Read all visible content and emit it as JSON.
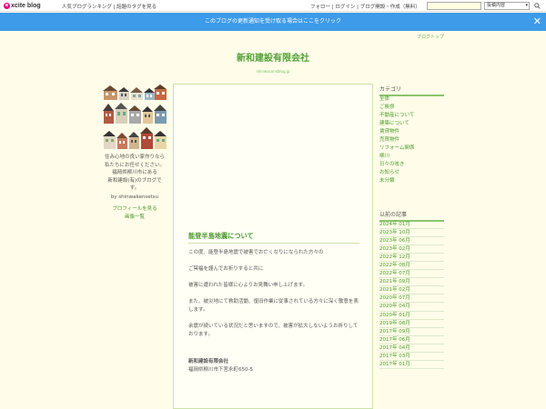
{
  "header": {
    "logo_mark": "e",
    "logo_text": "xcite blog",
    "links_left": "人気ブログランキング | 話題のタグを見る",
    "links_right": "フォロー | ログイン | ブログ開設・作成（無料）",
    "search_placeholder": "",
    "search_scope": "投稿内容"
  },
  "banner": {
    "text": "このブログの更新通知を受け取る場合はここをクリック",
    "close": "✕"
  },
  "blog": {
    "top_link": "ブログトップ",
    "title": "新和建設有限会社",
    "url": "shinwaconsblog.jp"
  },
  "profile": {
    "lines": [
      "住み心地の良い家作りなら",
      "私たちにお任せください。",
      "福岡県柳川市にある",
      "新和建設(有)のブログで",
      "す。"
    ],
    "by": "by shinwakensetsu",
    "profile_link": "プロフィールを見る",
    "image_link": "画像一覧"
  },
  "post": {
    "title": "能登半島地震について",
    "paragraphs": [
      "この度、能登半島地震で被害でお亡くなりになられた方々の",
      "ご冥福を謹んでお祈りすると共に",
      "被害に遭われた皆様に心よりお見舞い申し上げます。",
      "また、被災地にて救助活動、復旧作業に従事されている方々に深く敬意を表します。",
      "余震が続いている状況だと思いますので、被害が拡大しないようお祈りしております。"
    ],
    "sign_company": "新和建設有限会社",
    "sign_address": "福岡県柳川市下宮永町650-5"
  },
  "sidebar": {
    "category_heading": "カテゴリ",
    "categories": [
      "全体",
      "ご挨拶",
      "不動産について",
      "建築について",
      "賃貸物件",
      "売買物件",
      "リフォーム関係",
      "柳川",
      "日々の呟き",
      "お知らせ",
      "未分類"
    ],
    "archive_heading": "以前の記事",
    "archives": [
      "2024年 01月",
      "2023年 10月",
      "2023年 06月",
      "2023年 02月",
      "2022年 12月",
      "2022年 08月",
      "2022年 07月",
      "2021年 09月",
      "2021年 02月",
      "2020年 07月",
      "2020年 04月",
      "2020年 01月",
      "2019年 08月",
      "2017年 09月",
      "2017年 06月",
      "2017年 04月",
      "2017年 03月",
      "2017年 01月"
    ]
  },
  "colors": {
    "accent": "#53a238",
    "banner": "#3d9be9",
    "background": "#fffde9"
  }
}
